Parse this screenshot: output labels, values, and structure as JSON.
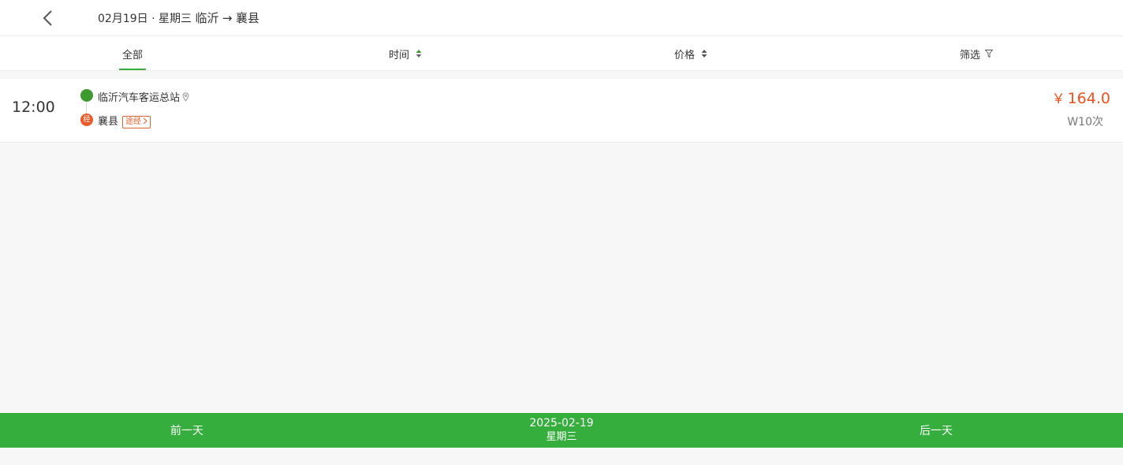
{
  "header": {
    "date": "02月19日",
    "separator": " · ",
    "weekday": "星期三",
    "route_from": "临沂",
    "route_arrow": "→",
    "route_to": "襄县"
  },
  "tabs": [
    {
      "label": "全部"
    },
    {
      "label": "时间"
    },
    {
      "label": "价格"
    },
    {
      "label": "筛选"
    }
  ],
  "trips": [
    {
      "time": "12:00",
      "from": "临沂汽车客运总站",
      "to": "襄县",
      "via_badge": "经",
      "via_label": "途经",
      "price_symbol": "￥",
      "price": "164.0",
      "bus_no": "W10次"
    }
  ],
  "bottom": {
    "prev": "前一天",
    "date": "2025-02-19",
    "weekday": "星期三",
    "next": "后一天"
  },
  "colors": {
    "accent_green": "#35ae3e",
    "price_red": "#f0501e",
    "via_orange": "#e85b2a"
  }
}
